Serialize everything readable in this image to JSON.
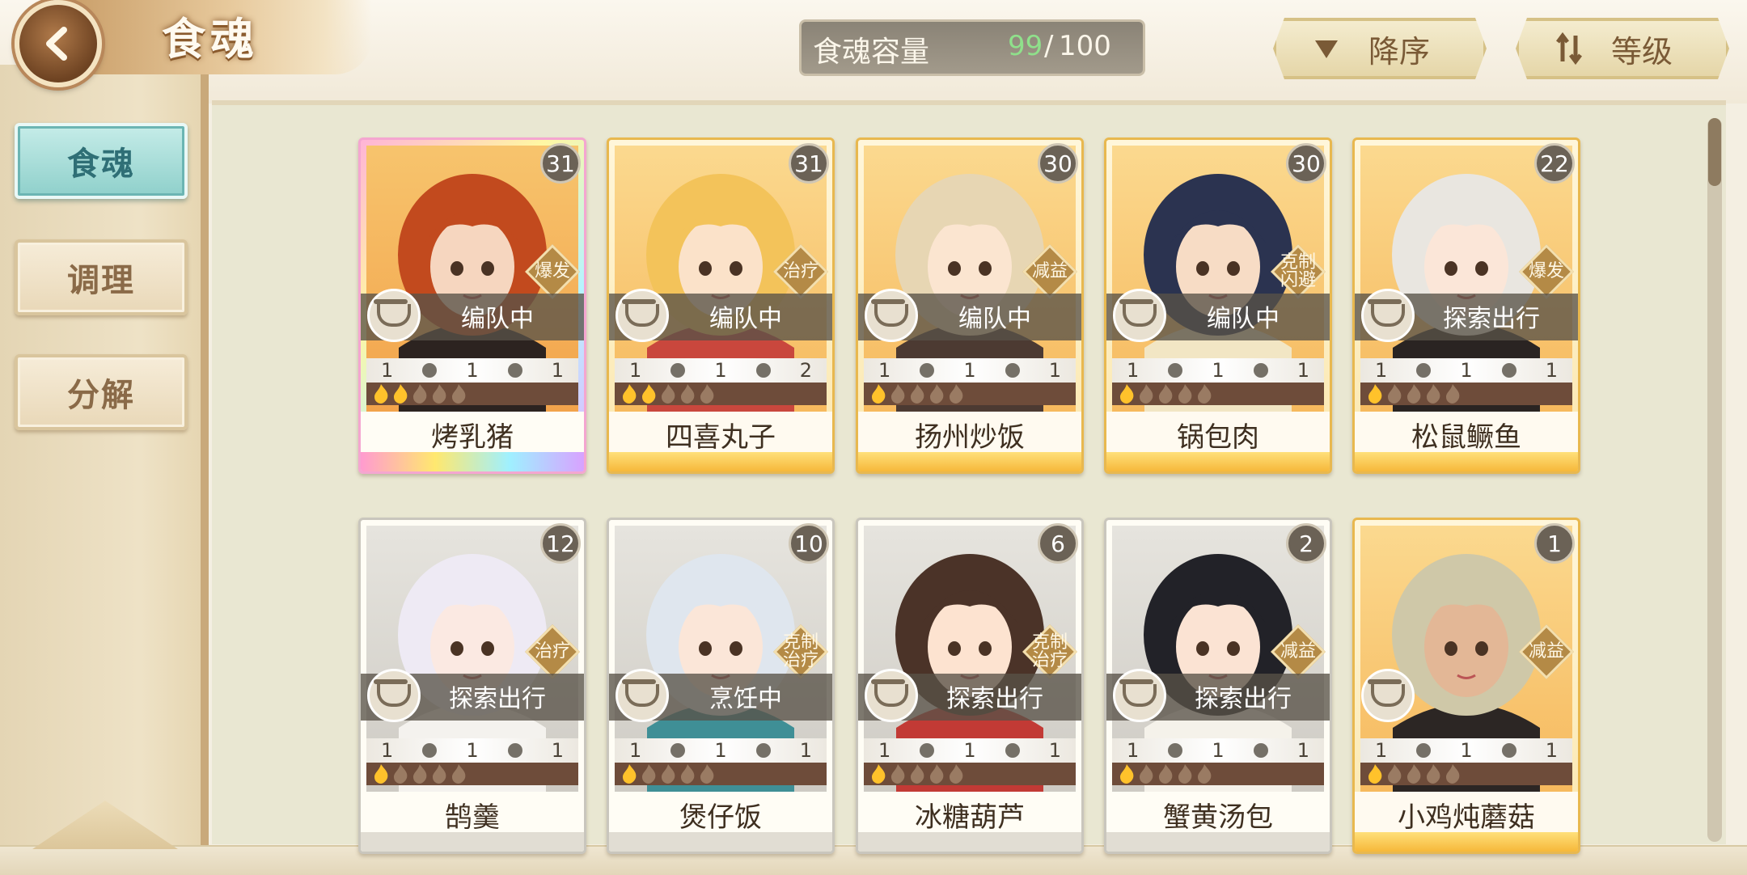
{
  "header": {
    "title": "食魂",
    "capacity_label": "食魂容量",
    "capacity_current": "99",
    "capacity_sep": "/",
    "capacity_max": "100",
    "sort_order_label": "降序",
    "sort_key_label": "等级"
  },
  "sidebar": {
    "items": [
      {
        "label": "食魂",
        "active": true
      },
      {
        "label": "调理",
        "active": false
      },
      {
        "label": "分解",
        "active": false
      }
    ]
  },
  "colors": {
    "capacity_current": "#8fe08b",
    "active_tab": "#8fd0cb",
    "star_on": "#ffc22b"
  },
  "cards": [
    {
      "name": "烤乳猪",
      "level": "31",
      "role": [
        "爆发"
      ],
      "status": "编队中",
      "stats": [
        "1",
        "1",
        "1"
      ],
      "stars": 2,
      "frame": "rainbow",
      "hair": "#c24a1e",
      "skin": "#f6d6bf",
      "cloth": "#2c2320"
    },
    {
      "name": "四喜丸子",
      "level": "31",
      "role": [
        "治疗"
      ],
      "status": "编队中",
      "stats": [
        "1",
        "1",
        "2"
      ],
      "stars": 2,
      "frame": "gold",
      "hair": "#f3c35a",
      "skin": "#fbe2c9",
      "cloth": "#c9473d"
    },
    {
      "name": "扬州炒饭",
      "level": "30",
      "role": [
        "减益"
      ],
      "status": "编队中",
      "stats": [
        "1",
        "1",
        "1"
      ],
      "stars": 1,
      "frame": "gold",
      "hair": "#e7d6b3",
      "skin": "#fbe5d0",
      "cloth": "#4c3a32"
    },
    {
      "name": "锅包肉",
      "level": "30",
      "role": [
        "克制",
        "闪避"
      ],
      "status": "编队中",
      "stats": [
        "1",
        "1",
        "1"
      ],
      "stars": 1,
      "frame": "gold",
      "hair": "#2b3350",
      "skin": "#f7dcc5",
      "cloth": "#f2e6c4"
    },
    {
      "name": "松鼠鳜鱼",
      "level": "22",
      "role": [
        "爆发"
      ],
      "status": "探索出行",
      "stats": [
        "1",
        "1",
        "1"
      ],
      "stars": 1,
      "frame": "gold",
      "hair": "#e9e6e0",
      "skin": "#fbe6d8",
      "cloth": "#2a2422"
    },
    {
      "name": "鹄羹",
      "level": "12",
      "role": [
        "治疗"
      ],
      "status": "探索出行",
      "stats": [
        "1",
        "1",
        "1"
      ],
      "stars": 1,
      "frame": "gray",
      "hair": "#eeeaf4",
      "skin": "#fbe9e2",
      "cloth": "#f4f2ee"
    },
    {
      "name": "煲仔饭",
      "level": "10",
      "role": [
        "克制",
        "治疗"
      ],
      "status": "烹饪中",
      "stats": [
        "1",
        "1",
        "1"
      ],
      "stars": 1,
      "frame": "gray",
      "hair": "#dfe6ee",
      "skin": "#fbe6d8",
      "cloth": "#3f8f96"
    },
    {
      "name": "冰糖葫芦",
      "level": "6",
      "role": [
        "克制",
        "治疗"
      ],
      "status": "探索出行",
      "stats": [
        "1",
        "1",
        "1"
      ],
      "stars": 1,
      "frame": "gray",
      "hair": "#4b3328",
      "skin": "#fde3d0",
      "cloth": "#c23a35"
    },
    {
      "name": "蟹黄汤包",
      "level": "2",
      "role": [
        "减益"
      ],
      "status": "探索出行",
      "stats": [
        "1",
        "1",
        "1"
      ],
      "stars": 1,
      "frame": "gray",
      "hair": "#222228",
      "skin": "#fbe3d3",
      "cloth": "#f5f2ea"
    },
    {
      "name": "小鸡炖蘑菇",
      "level": "1",
      "role": [
        "减益"
      ],
      "status": "",
      "stats": [
        "1",
        "1",
        "1"
      ],
      "stars": 1,
      "frame": "gold",
      "hair": "#cfc8a8",
      "skin": "#e3b796",
      "cloth": "#2c2624"
    }
  ]
}
